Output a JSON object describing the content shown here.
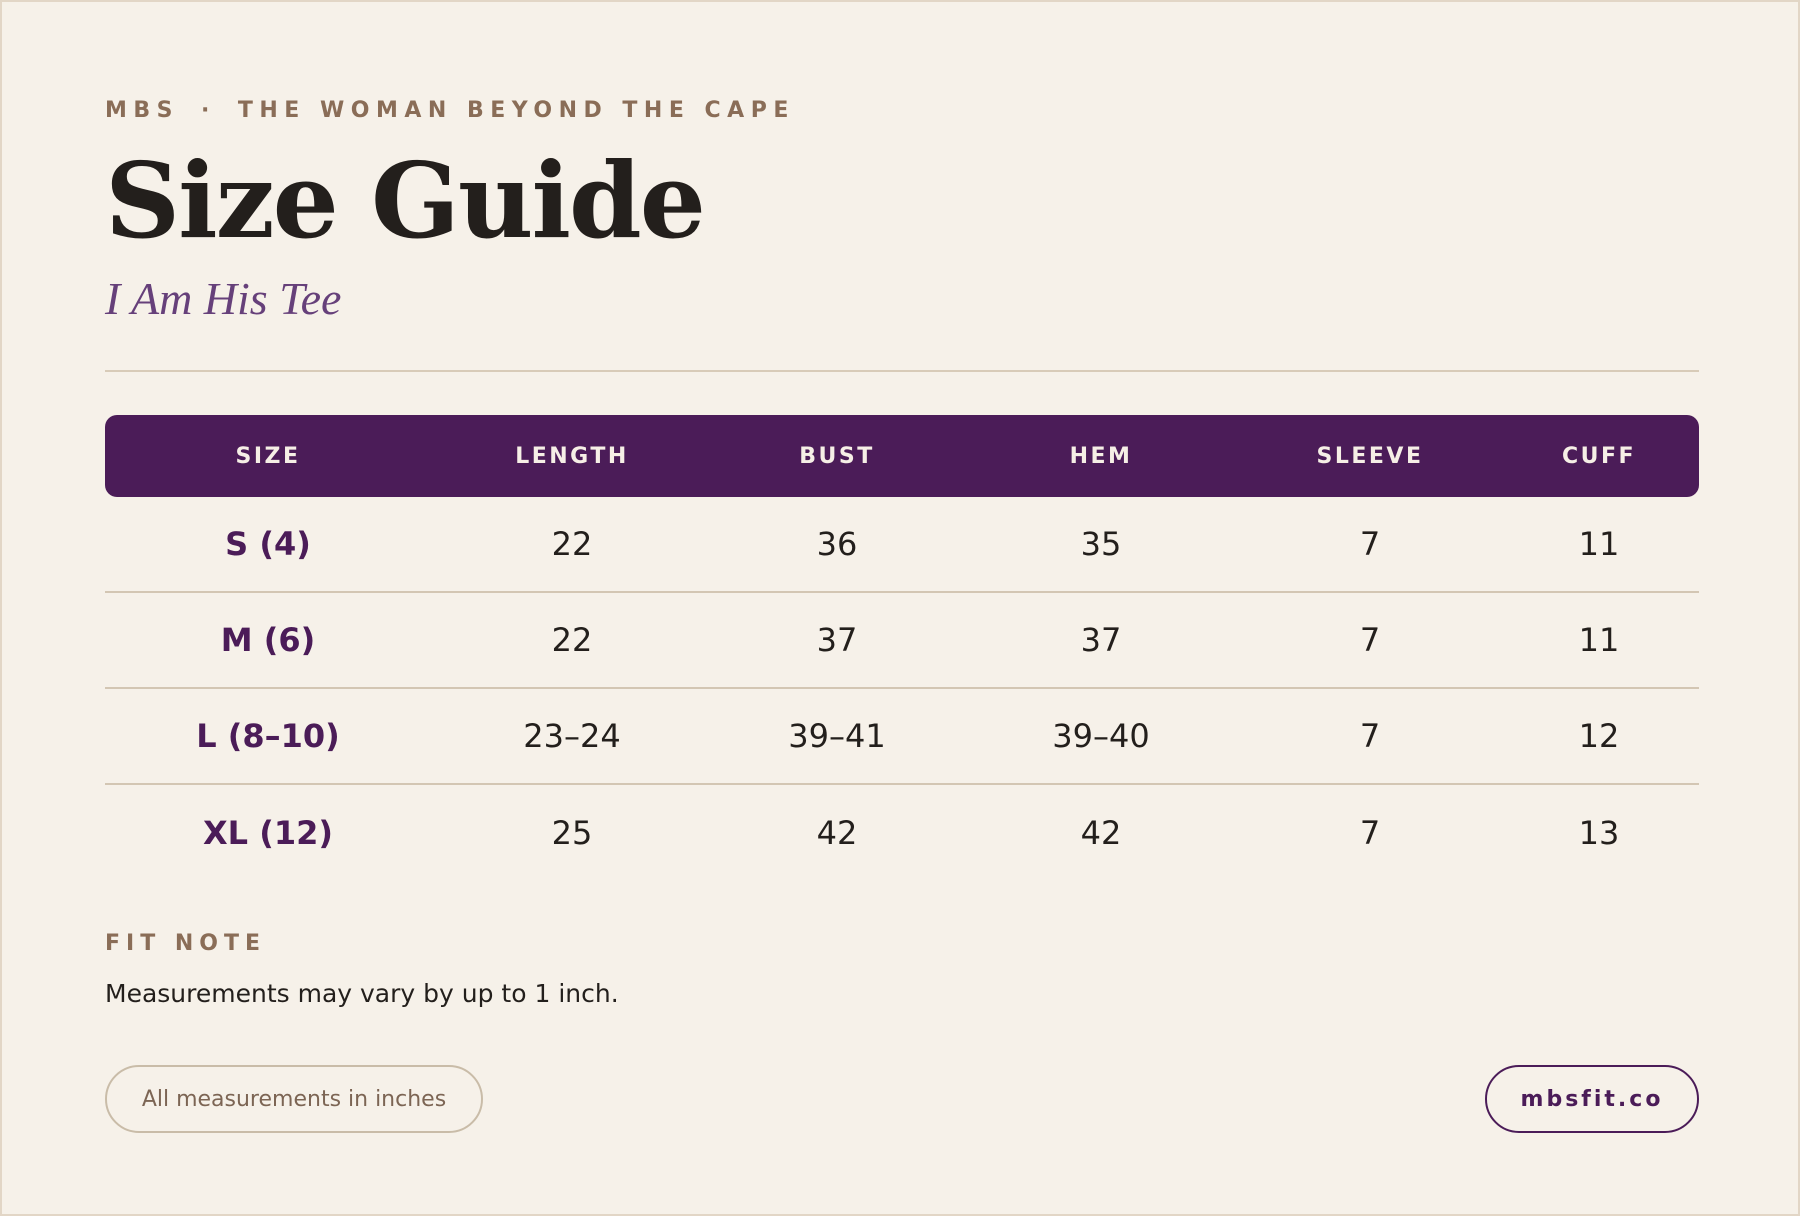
{
  "header": {
    "brand": "MBS",
    "separator": "·",
    "tagline": "THE WOMAN BEYOND THE CAPE",
    "title": "Size Guide",
    "subtitle": "I Am His Tee"
  },
  "table": {
    "headers": [
      "SIZE",
      "LENGTH",
      "BUST",
      "HEM",
      "SLEEVE",
      "CUFF"
    ],
    "rows": [
      [
        "S (4)",
        "22",
        "36",
        "35",
        "7",
        "11"
      ],
      [
        "M (6)",
        "22",
        "37",
        "37",
        "7",
        "11"
      ],
      [
        "L (8–10)",
        "23–24",
        "39–41",
        "39–40",
        "7",
        "12"
      ],
      [
        "XL (12)",
        "25",
        "42",
        "42",
        "7",
        "13"
      ]
    ]
  },
  "fit_note": {
    "label": "FIT NOTE",
    "text": "Measurements may vary by up to 1 inch."
  },
  "footer": {
    "units_label": "All measurements in inches",
    "website": "mbsfit.co"
  },
  "colors": {
    "background": "#f6f1e9",
    "accent": "#4b1c58",
    "muted": "#8a6d57",
    "subtitle": "#66407a"
  }
}
